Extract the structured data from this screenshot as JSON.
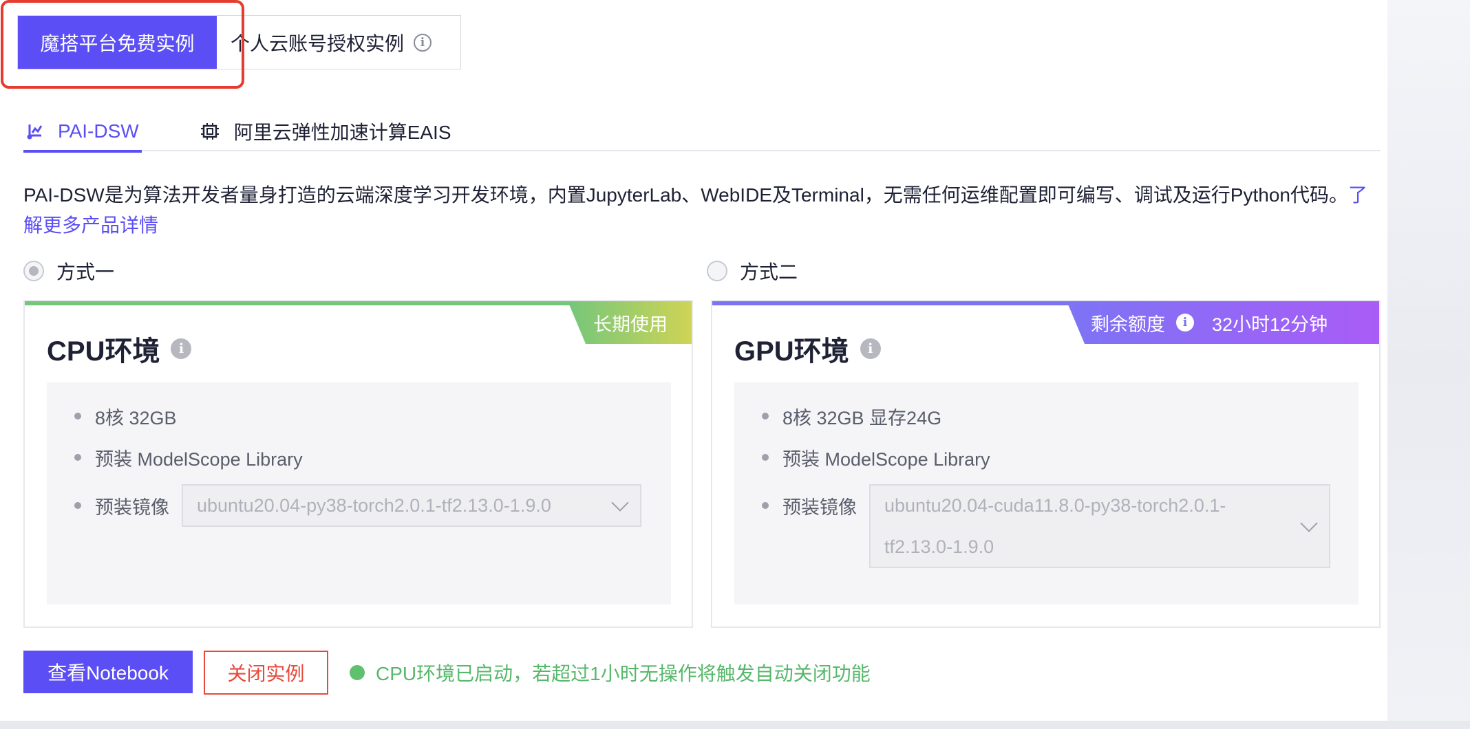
{
  "instance_tabs": {
    "active": "魔搭平台免费实例",
    "inactive": "个人云账号授权实例"
  },
  "service_tabs": {
    "dsw": "PAI-DSW",
    "eais": "阿里云弹性加速计算EAIS"
  },
  "description": {
    "text": "PAI-DSW是为算法开发者量身打造的云端深度学习开发环境，内置JupyterLab、WebIDE及Terminal，无需任何运维配置即可编写、调试及运行Python代码。",
    "link": "了解更多产品详情"
  },
  "options": {
    "one": "方式一",
    "two": "方式二"
  },
  "cpu_card": {
    "title": "CPU环境",
    "badge": "长期使用",
    "spec": "8核 32GB",
    "library": "预装 ModelScope Library",
    "image_label": "预装镜像",
    "image_value": "ubuntu20.04-py38-torch2.0.1-tf2.13.0-1.9.0"
  },
  "gpu_card": {
    "title": "GPU环境",
    "badge_label": "剩余额度",
    "badge_value": "32小时12分钟",
    "spec": "8核 32GB 显存24G",
    "library": "预装 ModelScope Library",
    "image_label": "预装镜像",
    "image_value_line1": "ubuntu20.04-cuda11.8.0-py38-torch2.0.1-",
    "image_value_line2": "tf2.13.0-1.9.0"
  },
  "actions": {
    "view_notebook": "查看Notebook",
    "close_instance": "关闭实例"
  },
  "status": {
    "text": "CPU环境已启动，若超过1小时无操作将触发自动关闭功能"
  },
  "colors": {
    "primary": "#5b4ef5",
    "danger": "#e64a3c",
    "success": "#56b86a",
    "highlight": "#e63b2e"
  }
}
